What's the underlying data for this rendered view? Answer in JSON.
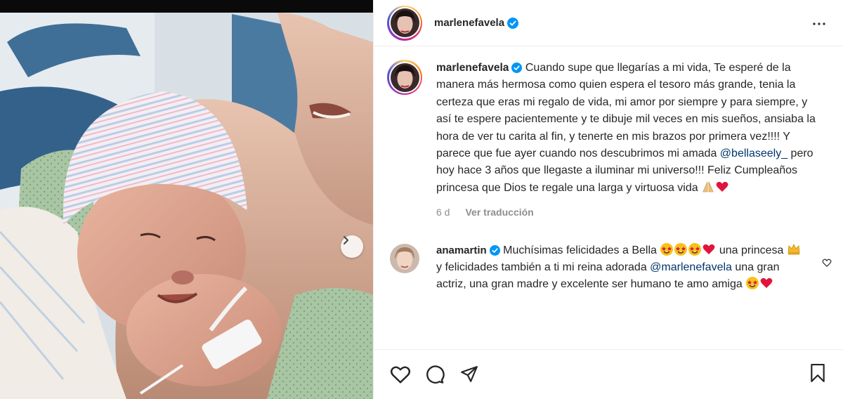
{
  "post": {
    "author": "marlenefavela",
    "verified": true
  },
  "caption": {
    "username": "marlenefavela",
    "text_1": "Cuando supe que llegarías a mi vida, Te esperé de la manera más hermosa como quien espera el tesoro más grande, tenia la certeza que eras mi regalo de vida, mi amor por siempre y para siempre, y así te espere pacientemente y te dibuje mil veces en mis sueños, ansiaba la hora de ver tu carita al fin, y tenerte en mis brazos por primera vez!!!! Y parece que fue ayer cuando nos descubrimos mi amada ",
    "mention": "@bellaseely_",
    "text_2": " pero hoy hace 3 años que llegaste a iluminar mi universo!!! Feliz Cumpleaños princesa que Dios te regale una larga y virtuosa vida ",
    "emojis": [
      "praying-hands",
      "red-heart"
    ],
    "age": "6 d",
    "translate_label": "Ver traducción"
  },
  "comment": {
    "username": "anamartin",
    "verified": true,
    "text_1": "Muchísimas felicidades a Bella ",
    "text_2": " una princesa ",
    "text_3": " y felicidades también a ti mi reina adorada ",
    "mention": "@marlenefavela",
    "text_4": " una gran actriz, una gran madre y excelente ser humano te amo amiga "
  },
  "colors": {
    "verified_blue": "#0095f6",
    "mention_blue": "#00376b",
    "heart_red": "#ed4956",
    "border": "#efefef",
    "muted": "#8e8e8e"
  },
  "icons": {
    "header_more": "more-horizontal-icon",
    "actions": [
      "heart-icon",
      "comment-icon",
      "share-icon",
      "bookmark-icon"
    ],
    "carousel": "chevron-right-icon"
  }
}
